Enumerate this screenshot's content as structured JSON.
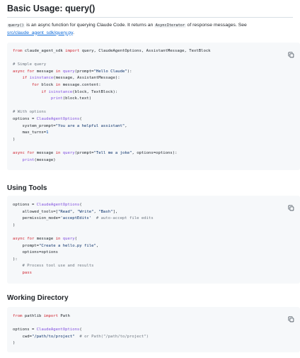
{
  "section1": {
    "title": "Basic Usage: query()",
    "intro": {
      "code1": "query()",
      "text1": " is an async function for querying Claude Code. It returns an ",
      "code2": "AsyncIterator",
      "text2": " of response messages. See ",
      "link": "src/claude_agent_sdk/query.py",
      "text3": "."
    },
    "code_lines": [
      [
        [
          "kw",
          "from"
        ],
        [
          "t",
          " claude_agent_sdk "
        ],
        [
          "kw",
          "import"
        ],
        [
          "t",
          " query, ClaudeAgentOptions, AssistantMessage, TextBlock"
        ]
      ],
      [],
      [
        [
          "cm",
          "# Simple query"
        ]
      ],
      [
        [
          "kw",
          "async"
        ],
        [
          "t",
          " "
        ],
        [
          "kw",
          "for"
        ],
        [
          "t",
          " message "
        ],
        [
          "kw",
          "in"
        ],
        [
          "t",
          " "
        ],
        [
          "fn",
          "query"
        ],
        [
          "t",
          "(prompt="
        ],
        [
          "st",
          "\"Hello Claude\""
        ],
        [
          "t",
          "):"
        ]
      ],
      [
        [
          "t",
          "    "
        ],
        [
          "kw",
          "if"
        ],
        [
          "t",
          " "
        ],
        [
          "fn",
          "isinstance"
        ],
        [
          "t",
          "(message, AssistantMessage):"
        ]
      ],
      [
        [
          "t",
          "        "
        ],
        [
          "kw",
          "for"
        ],
        [
          "t",
          " block "
        ],
        [
          "kw",
          "in"
        ],
        [
          "t",
          " message.content:"
        ]
      ],
      [
        [
          "t",
          "            "
        ],
        [
          "kw",
          "if"
        ],
        [
          "t",
          " "
        ],
        [
          "fn",
          "isinstance"
        ],
        [
          "t",
          "(block, TextBlock):"
        ]
      ],
      [
        [
          "t",
          "                "
        ],
        [
          "fn",
          "print"
        ],
        [
          "t",
          "(block.text)"
        ]
      ],
      [],
      [
        [
          "cm",
          "# With options"
        ]
      ],
      [
        [
          "t",
          "options = "
        ],
        [
          "fn",
          "ClaudeAgentOptions"
        ],
        [
          "t",
          "("
        ]
      ],
      [
        [
          "t",
          "    system_prompt="
        ],
        [
          "st",
          "\"You are a helpful assistant\""
        ],
        [
          "t",
          ","
        ]
      ],
      [
        [
          "t",
          "    max_turns="
        ],
        [
          "nm",
          "1"
        ]
      ],
      [
        [
          "t",
          ")"
        ]
      ],
      [],
      [
        [
          "kw",
          "async"
        ],
        [
          "t",
          " "
        ],
        [
          "kw",
          "for"
        ],
        [
          "t",
          " message "
        ],
        [
          "kw",
          "in"
        ],
        [
          "t",
          " "
        ],
        [
          "fn",
          "query"
        ],
        [
          "t",
          "(prompt="
        ],
        [
          "st",
          "\"Tell me a joke\""
        ],
        [
          "t",
          ", options=options):"
        ]
      ],
      [
        [
          "t",
          "    "
        ],
        [
          "fn",
          "print"
        ],
        [
          "t",
          "(message)"
        ]
      ]
    ]
  },
  "section2": {
    "title": "Using Tools",
    "code_lines": [
      [
        [
          "t",
          "options = "
        ],
        [
          "fn",
          "ClaudeAgentOptions"
        ],
        [
          "t",
          "("
        ]
      ],
      [
        [
          "t",
          "    allowed_tools=["
        ],
        [
          "st",
          "\"Read\""
        ],
        [
          "t",
          ", "
        ],
        [
          "st",
          "\"Write\""
        ],
        [
          "t",
          ", "
        ],
        [
          "st",
          "\"Bash\""
        ],
        [
          "t",
          "],"
        ]
      ],
      [
        [
          "t",
          "    permission_mode="
        ],
        [
          "st",
          "'acceptEdits'"
        ],
        [
          "t",
          "  "
        ],
        [
          "cm",
          "# auto-accept file edits"
        ]
      ],
      [
        [
          "t",
          ")"
        ]
      ],
      [],
      [
        [
          "kw",
          "async"
        ],
        [
          "t",
          " "
        ],
        [
          "kw",
          "for"
        ],
        [
          "t",
          " message "
        ],
        [
          "kw",
          "in"
        ],
        [
          "t",
          " "
        ],
        [
          "fn",
          "query"
        ],
        [
          "t",
          "("
        ]
      ],
      [
        [
          "t",
          "    prompt="
        ],
        [
          "st",
          "\"Create a hello.py file\""
        ],
        [
          "t",
          ","
        ]
      ],
      [
        [
          "t",
          "    options=options"
        ]
      ],
      [
        [
          "t",
          "):"
        ]
      ],
      [
        [
          "t",
          "    "
        ],
        [
          "cm",
          "# Process tool use and results"
        ]
      ],
      [
        [
          "t",
          "    "
        ],
        [
          "kw",
          "pass"
        ]
      ]
    ]
  },
  "section3": {
    "title": "Working Directory",
    "code_lines": [
      [
        [
          "kw",
          "from"
        ],
        [
          "t",
          " pathlib "
        ],
        [
          "kw",
          "import"
        ],
        [
          "t",
          " Path"
        ]
      ],
      [],
      [
        [
          "t",
          "options = "
        ],
        [
          "fn",
          "ClaudeAgentOptions"
        ],
        [
          "t",
          "("
        ]
      ],
      [
        [
          "t",
          "    cwd="
        ],
        [
          "st",
          "\"/path/to/project\""
        ],
        [
          "t",
          "  "
        ],
        [
          "cm",
          "# or Path(\"/path/to/project\")"
        ]
      ],
      [
        [
          "t",
          ")"
        ]
      ]
    ]
  },
  "icons": {
    "copy": "copy-icon"
  }
}
